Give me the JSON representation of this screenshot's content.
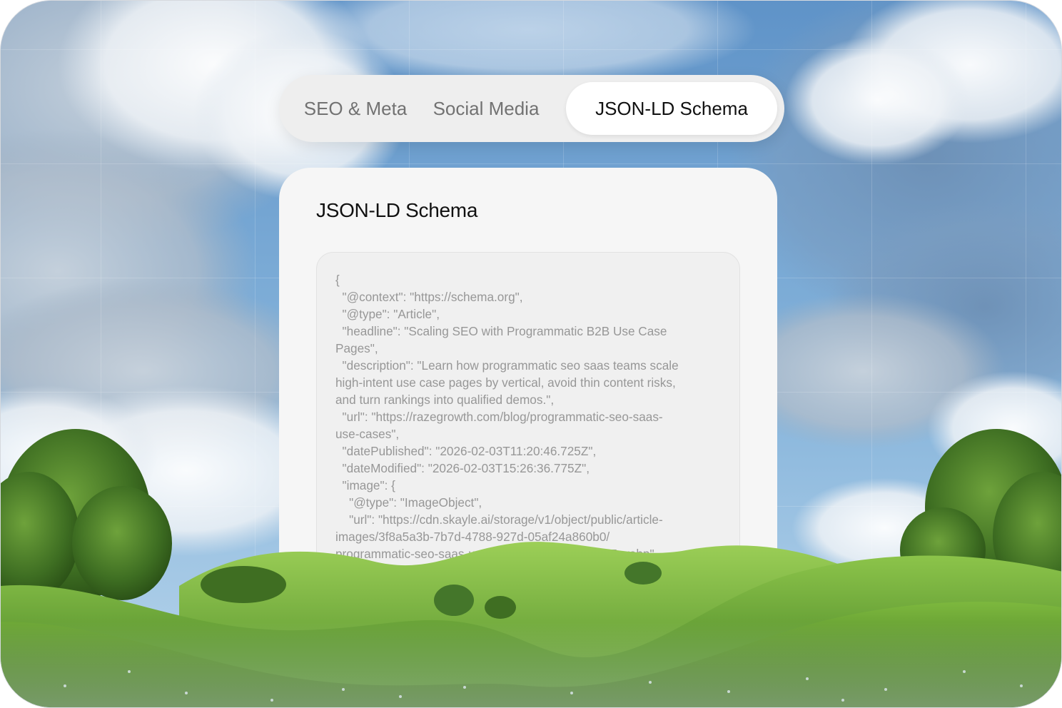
{
  "tabs": {
    "seo_label": "SEO & Meta",
    "social_label": "Social Media",
    "jsonld_label": "JSON-LD Schema",
    "active": "JSON-LD Schema"
  },
  "card": {
    "title": "JSON-LD Schema",
    "code_text": "{\n  \"@context\": \"https://schema.org\",\n  \"@type\": \"Article\",\n  \"headline\": \"Scaling SEO with Programmatic B2B Use Case\nPages\",\n  \"description\": \"Learn how programmatic seo saas teams scale\nhigh-intent use case pages by vertical, avoid thin content risks,\nand turn rankings into qualified demos.\",\n  \"url\": \"https://razegrowth.com/blog/programmatic-seo-saas-\nuse-cases\",\n  \"datePublished\": \"2026-02-03T11:20:46.725Z\",\n  \"dateModified\": \"2026-02-03T15:26:36.775Z\",\n  \"image\": {\n    \"@type\": \"ImageObject\",\n    \"url\": \"https://cdn.skayle.ai/storage/v1/object/public/article-\nimages/3f8a5a3b-7b7d-4788-927d-05af24a860b0/\nprogrammatic-seo-saas-use-cases-1770130671537.webp\"\n..."
  },
  "colors": {
    "tab_bar_bg": "#eeeeee",
    "active_tab_bg": "#ffffff",
    "card_bg": "#f6f6f6",
    "code_text": "#979797"
  }
}
